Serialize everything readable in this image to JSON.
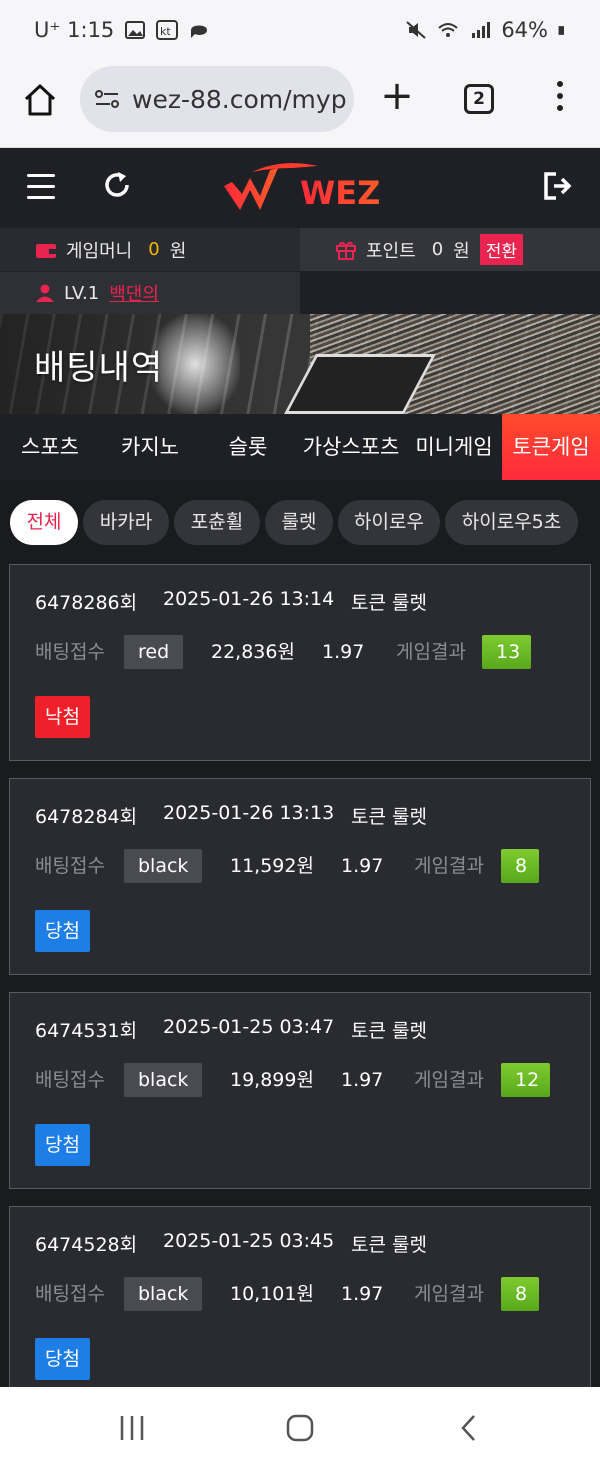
{
  "status_bar": {
    "carrier": "U⁺ 1:15",
    "battery": "64%"
  },
  "browser": {
    "url": "wez-88.com/myp",
    "tab_count": "2"
  },
  "header": {
    "logo_text": "WEZ"
  },
  "account": {
    "game_money_label": "게임머니",
    "game_money_value": "0",
    "game_money_unit": "원",
    "point_label": "포인트",
    "point_value": "0",
    "point_unit": "원",
    "swap_label": "전환",
    "level": "LV.1",
    "nickname": "백댄의"
  },
  "banner": {
    "title": "배팅내역"
  },
  "category_tabs": [
    {
      "label": "스포츠"
    },
    {
      "label": "카지노"
    },
    {
      "label": "슬롯"
    },
    {
      "label": "가상스포츠"
    },
    {
      "label": "미니게임"
    },
    {
      "label": "토큰게임",
      "active": true
    }
  ],
  "sub_tabs": [
    {
      "label": "전체",
      "active": true
    },
    {
      "label": "바카라"
    },
    {
      "label": "포츈휠"
    },
    {
      "label": "룰렛"
    },
    {
      "label": "하이로우"
    },
    {
      "label": "하이로우5초"
    }
  ],
  "bets": [
    {
      "round": "6478286회",
      "datetime": "2025-01-26 13:14",
      "game": "토큰 룰렛",
      "accept_label": "배팅접수",
      "pick": "red",
      "amount": "22,836원",
      "odds": "1.97",
      "result_label": "게임결과",
      "result": "13",
      "status": "낙첨",
      "status_type": "lose"
    },
    {
      "round": "6478284회",
      "datetime": "2025-01-26 13:13",
      "game": "토큰 룰렛",
      "accept_label": "배팅접수",
      "pick": "black",
      "amount": "11,592원",
      "odds": "1.97",
      "result_label": "게임결과",
      "result": "8",
      "status": "당첨",
      "status_type": "win"
    },
    {
      "round": "6474531회",
      "datetime": "2025-01-25 03:47",
      "game": "토큰 룰렛",
      "accept_label": "배팅접수",
      "pick": "black",
      "amount": "19,899원",
      "odds": "1.97",
      "result_label": "게임결과",
      "result": "12",
      "status": "당첨",
      "status_type": "win"
    },
    {
      "round": "6474528회",
      "datetime": "2025-01-25 03:45",
      "game": "토큰 룰렛",
      "accept_label": "배팅접수",
      "pick": "black",
      "amount": "10,101원",
      "odds": "1.97",
      "result_label": "게임결과",
      "result": "8",
      "status": "당첨",
      "status_type": "win"
    }
  ],
  "colors": {
    "accent_red": "#e8244f",
    "win_blue": "#1e7ee8",
    "lose_red": "#f0202a",
    "result_green": "#6abb25",
    "money_yellow": "#f5b800"
  }
}
